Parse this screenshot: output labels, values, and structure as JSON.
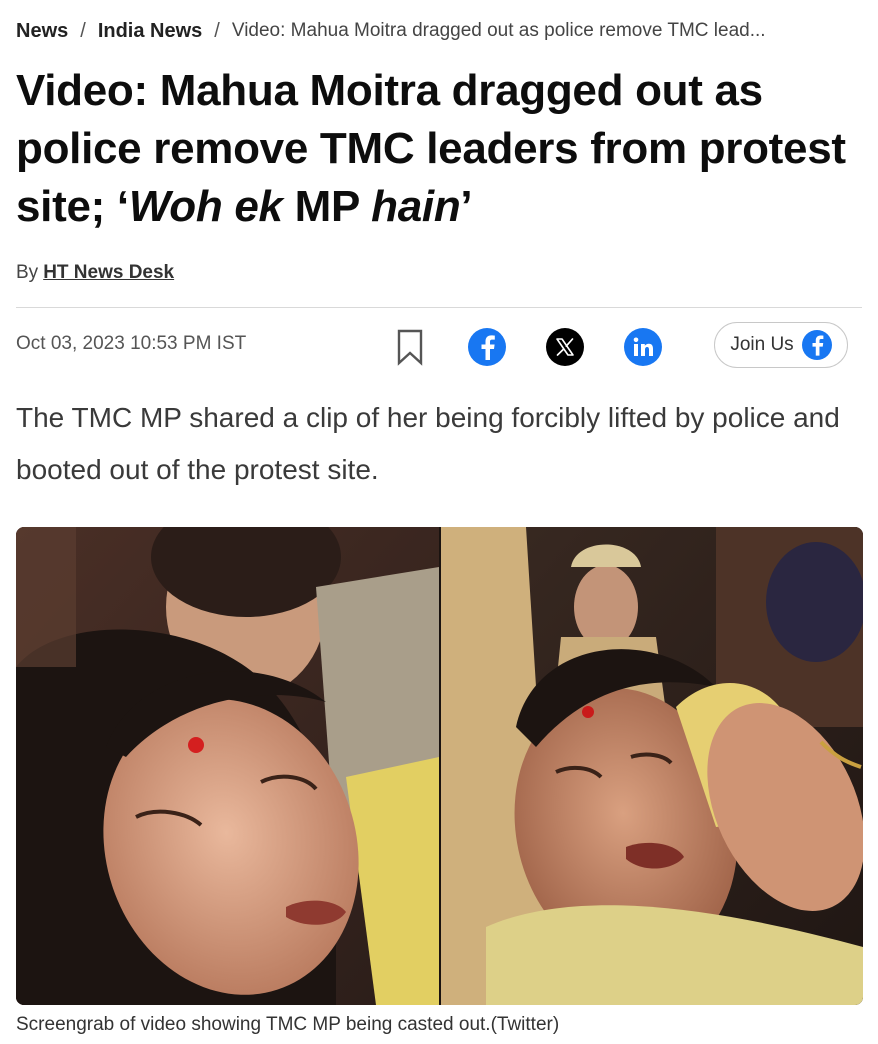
{
  "breadcrumb": {
    "items": [
      "News",
      "India News"
    ],
    "separator": "/",
    "current": "Video: Mahua Moitra dragged out as police remove TMC lead..."
  },
  "headline": {
    "main": "Video: Mahua Moitra dragged out as police remove TMC leaders from protest site; ",
    "open_quote": "‘",
    "quote_part1": "Woh ek",
    "quote_part2": " MP ",
    "quote_part3": "hain",
    "close_quote": "’"
  },
  "byline": {
    "prefix": "By",
    "author": "HT News Desk"
  },
  "article": {
    "date": "Oct 03, 2023 10:53 PM IST",
    "summary": "The TMC MP shared a clip of her being forcibly lifted by police and booted out of the protest site."
  },
  "share": {
    "icons": [
      "bookmark-icon",
      "facebook-icon",
      "x-icon",
      "linkedin-icon"
    ],
    "colors": {
      "facebook": "#1877f2",
      "x": "#000000",
      "linkedin": "#1877f2"
    },
    "join_label": "Join Us"
  },
  "photo": {
    "caption": "Screengrab of video showing TMC MP being casted out.(Twitter)"
  }
}
